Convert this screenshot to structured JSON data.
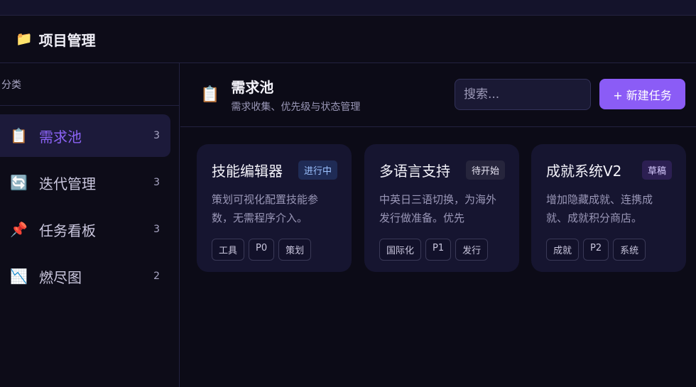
{
  "header": {
    "app_icon": "📁",
    "app_title": "项目管理"
  },
  "sidebar": {
    "section_label": "分类",
    "items": [
      {
        "icon": "📋",
        "label": "需求池",
        "count": "3",
        "active": true
      },
      {
        "icon": "🔄",
        "label": "迭代管理",
        "count": "3",
        "active": false
      },
      {
        "icon": "📌",
        "label": "任务看板",
        "count": "3",
        "active": false
      },
      {
        "icon": "📉",
        "label": "燃尽图",
        "count": "2",
        "active": false
      }
    ]
  },
  "main": {
    "page_icon": "📋",
    "page_title": "需求池",
    "page_subtitle": "需求收集、优先级与状态管理",
    "search_placeholder": "搜索...",
    "new_task_label": "+ 新建任务",
    "cards": [
      {
        "title": "技能编辑器",
        "status": "进行中",
        "description": "策划可视化配置技能参数，无需程序介入。",
        "tags": [
          "工具",
          "P0",
          "策划"
        ]
      },
      {
        "title": "多语言支持",
        "status": "待开始",
        "description": "中英日三语切换，为海外发行做准备。优先",
        "tags": [
          "国际化",
          "P1",
          "发行"
        ]
      },
      {
        "title": "成就系统V2",
        "status": "草稿",
        "description": "增加隐藏成就、连携成就、成就积分商店。",
        "tags": [
          "成就",
          "P2",
          "系统"
        ]
      }
    ]
  },
  "colors": {
    "accent": "#8b5cf6",
    "active_label": "#8b63f5",
    "badge_in_progress": "#9cc2ff",
    "badge_draft": "#d8cbff"
  }
}
